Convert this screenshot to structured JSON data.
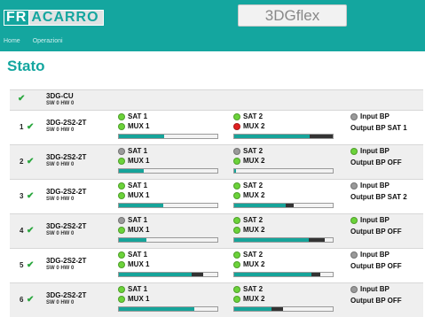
{
  "header": {
    "logo": {
      "part1": "FR",
      "part2": "ACARRO"
    },
    "product_label": "3DGflex",
    "nav": [
      "Home",
      "Operazioni"
    ]
  },
  "page_title": "Stato",
  "colors": {
    "accent": "#14a69f",
    "led_green": "#6bd33a",
    "led_gray": "#9a9a9a",
    "led_red": "#e02020",
    "bar_fill": "#16a49a"
  },
  "top_row": {
    "name": "3DG-CU",
    "fw": "SW 0 HW 0",
    "status_icon": "check-icon"
  },
  "rows": [
    {
      "idx": "1",
      "name": "3DG-2S2-2T",
      "fw": "SW 0 HW 0",
      "sat1": {
        "led": "green",
        "label": "SAT 1",
        "mux_led": "green",
        "mux_label": "MUX 1",
        "level": 0.46,
        "dark": 0
      },
      "sat2": {
        "led": "green",
        "label": "SAT 2",
        "mux_led": "red",
        "mux_label": "MUX 2",
        "level": 0.77,
        "dark": 0.23
      },
      "bp": {
        "led": "gray",
        "label": "Input BP",
        "output": "Output BP SAT 1"
      }
    },
    {
      "idx": "2",
      "name": "3DG-2S2-2T",
      "fw": "SW 0 HW 0",
      "sat1": {
        "led": "gray",
        "label": "SAT 1",
        "mux_led": "green",
        "mux_label": "MUX 1",
        "level": 0.25,
        "dark": 0
      },
      "sat2": {
        "led": "gray",
        "label": "SAT 2",
        "mux_led": "green",
        "mux_label": "MUX 2",
        "level": 0.02,
        "dark": 0
      },
      "bp": {
        "led": "green",
        "label": "Input BP",
        "output": "Output BP OFF"
      }
    },
    {
      "idx": "3",
      "name": "3DG-2S2-2T",
      "fw": "SW 0 HW 0",
      "sat1": {
        "led": "green",
        "label": "SAT 1",
        "mux_led": "green",
        "mux_label": "MUX 1",
        "level": 0.45,
        "dark": 0
      },
      "sat2": {
        "led": "green",
        "label": "SAT 2",
        "mux_led": "green",
        "mux_label": "MUX 2",
        "level": 0.52,
        "dark": 0.08
      },
      "bp": {
        "led": "gray",
        "label": "Input BP",
        "output": "Output BP SAT 2"
      }
    },
    {
      "idx": "4",
      "name": "3DG-2S2-2T",
      "fw": "SW 0 HW 0",
      "sat1": {
        "led": "gray",
        "label": "SAT 1",
        "mux_led": "green",
        "mux_label": "MUX 1",
        "level": 0.28,
        "dark": 0
      },
      "sat2": {
        "led": "green",
        "label": "SAT 2",
        "mux_led": "green",
        "mux_label": "MUX 2",
        "level": 0.76,
        "dark": 0.16
      },
      "bp": {
        "led": "green",
        "label": "Input BP",
        "output": "Output BP OFF"
      }
    },
    {
      "idx": "5",
      "name": "3DG-2S2-2T",
      "fw": "SW 0 HW 0",
      "sat1": {
        "led": "green",
        "label": "SAT 1",
        "mux_led": "green",
        "mux_label": "MUX 1",
        "level": 0.74,
        "dark": 0.12
      },
      "sat2": {
        "led": "green",
        "label": "SAT 2",
        "mux_led": "green",
        "mux_label": "MUX 2",
        "level": 0.78,
        "dark": 0.09
      },
      "bp": {
        "led": "gray",
        "label": "Input BP",
        "output": "Output BP OFF"
      }
    },
    {
      "idx": "6",
      "name": "3DG-2S2-2T",
      "fw": "SW 0 HW 0",
      "sat1": {
        "led": "green",
        "label": "SAT 1",
        "mux_led": "green",
        "mux_label": "MUX 1",
        "level": 0.77,
        "dark": 0
      },
      "sat2": {
        "led": "green",
        "label": "SAT 2",
        "mux_led": "green",
        "mux_label": "MUX 2",
        "level": 0.38,
        "dark": 0.12
      },
      "bp": {
        "led": "gray",
        "label": "Input BP",
        "output": "Output BP OFF"
      }
    }
  ]
}
